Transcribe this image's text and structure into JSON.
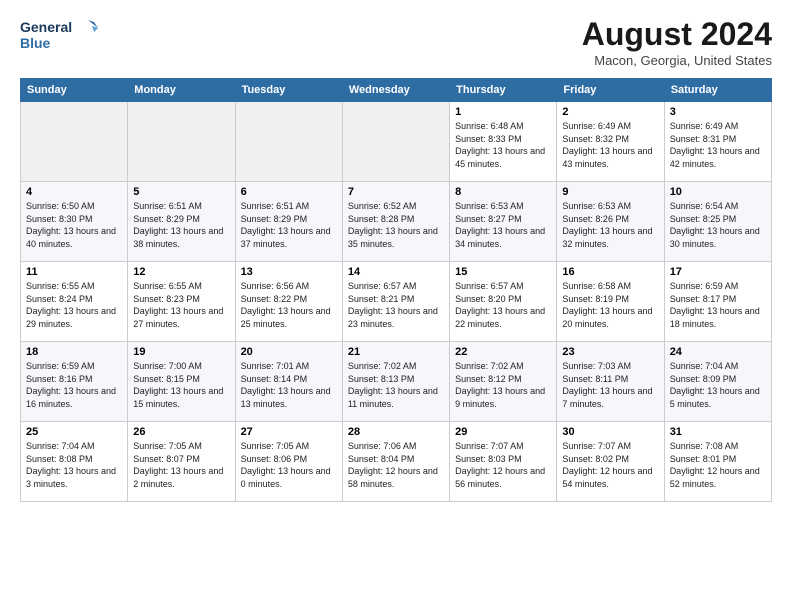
{
  "logo": {
    "line1": "General",
    "line2": "Blue"
  },
  "title": "August 2024",
  "location": "Macon, Georgia, United States",
  "days_of_week": [
    "Sunday",
    "Monday",
    "Tuesday",
    "Wednesday",
    "Thursday",
    "Friday",
    "Saturday"
  ],
  "weeks": [
    [
      {
        "day": "",
        "empty": true
      },
      {
        "day": "",
        "empty": true
      },
      {
        "day": "",
        "empty": true
      },
      {
        "day": "",
        "empty": true
      },
      {
        "day": "1",
        "sunrise": "6:48 AM",
        "sunset": "8:33 PM",
        "daylight": "13 hours and 45 minutes."
      },
      {
        "day": "2",
        "sunrise": "6:49 AM",
        "sunset": "8:32 PM",
        "daylight": "13 hours and 43 minutes."
      },
      {
        "day": "3",
        "sunrise": "6:49 AM",
        "sunset": "8:31 PM",
        "daylight": "13 hours and 42 minutes."
      }
    ],
    [
      {
        "day": "4",
        "sunrise": "6:50 AM",
        "sunset": "8:30 PM",
        "daylight": "13 hours and 40 minutes."
      },
      {
        "day": "5",
        "sunrise": "6:51 AM",
        "sunset": "8:29 PM",
        "daylight": "13 hours and 38 minutes."
      },
      {
        "day": "6",
        "sunrise": "6:51 AM",
        "sunset": "8:29 PM",
        "daylight": "13 hours and 37 minutes."
      },
      {
        "day": "7",
        "sunrise": "6:52 AM",
        "sunset": "8:28 PM",
        "daylight": "13 hours and 35 minutes."
      },
      {
        "day": "8",
        "sunrise": "6:53 AM",
        "sunset": "8:27 PM",
        "daylight": "13 hours and 34 minutes."
      },
      {
        "day": "9",
        "sunrise": "6:53 AM",
        "sunset": "8:26 PM",
        "daylight": "13 hours and 32 minutes."
      },
      {
        "day": "10",
        "sunrise": "6:54 AM",
        "sunset": "8:25 PM",
        "daylight": "13 hours and 30 minutes."
      }
    ],
    [
      {
        "day": "11",
        "sunrise": "6:55 AM",
        "sunset": "8:24 PM",
        "daylight": "13 hours and 29 minutes."
      },
      {
        "day": "12",
        "sunrise": "6:55 AM",
        "sunset": "8:23 PM",
        "daylight": "13 hours and 27 minutes."
      },
      {
        "day": "13",
        "sunrise": "6:56 AM",
        "sunset": "8:22 PM",
        "daylight": "13 hours and 25 minutes."
      },
      {
        "day": "14",
        "sunrise": "6:57 AM",
        "sunset": "8:21 PM",
        "daylight": "13 hours and 23 minutes."
      },
      {
        "day": "15",
        "sunrise": "6:57 AM",
        "sunset": "8:20 PM",
        "daylight": "13 hours and 22 minutes."
      },
      {
        "day": "16",
        "sunrise": "6:58 AM",
        "sunset": "8:19 PM",
        "daylight": "13 hours and 20 minutes."
      },
      {
        "day": "17",
        "sunrise": "6:59 AM",
        "sunset": "8:17 PM",
        "daylight": "13 hours and 18 minutes."
      }
    ],
    [
      {
        "day": "18",
        "sunrise": "6:59 AM",
        "sunset": "8:16 PM",
        "daylight": "13 hours and 16 minutes."
      },
      {
        "day": "19",
        "sunrise": "7:00 AM",
        "sunset": "8:15 PM",
        "daylight": "13 hours and 15 minutes."
      },
      {
        "day": "20",
        "sunrise": "7:01 AM",
        "sunset": "8:14 PM",
        "daylight": "13 hours and 13 minutes."
      },
      {
        "day": "21",
        "sunrise": "7:02 AM",
        "sunset": "8:13 PM",
        "daylight": "13 hours and 11 minutes."
      },
      {
        "day": "22",
        "sunrise": "7:02 AM",
        "sunset": "8:12 PM",
        "daylight": "13 hours and 9 minutes."
      },
      {
        "day": "23",
        "sunrise": "7:03 AM",
        "sunset": "8:11 PM",
        "daylight": "13 hours and 7 minutes."
      },
      {
        "day": "24",
        "sunrise": "7:04 AM",
        "sunset": "8:09 PM",
        "daylight": "13 hours and 5 minutes."
      }
    ],
    [
      {
        "day": "25",
        "sunrise": "7:04 AM",
        "sunset": "8:08 PM",
        "daylight": "13 hours and 3 minutes."
      },
      {
        "day": "26",
        "sunrise": "7:05 AM",
        "sunset": "8:07 PM",
        "daylight": "13 hours and 2 minutes."
      },
      {
        "day": "27",
        "sunrise": "7:05 AM",
        "sunset": "8:06 PM",
        "daylight": "13 hours and 0 minutes."
      },
      {
        "day": "28",
        "sunrise": "7:06 AM",
        "sunset": "8:04 PM",
        "daylight": "12 hours and 58 minutes."
      },
      {
        "day": "29",
        "sunrise": "7:07 AM",
        "sunset": "8:03 PM",
        "daylight": "12 hours and 56 minutes."
      },
      {
        "day": "30",
        "sunrise": "7:07 AM",
        "sunset": "8:02 PM",
        "daylight": "12 hours and 54 minutes."
      },
      {
        "day": "31",
        "sunrise": "7:08 AM",
        "sunset": "8:01 PM",
        "daylight": "12 hours and 52 minutes."
      }
    ]
  ],
  "labels": {
    "sunrise": "Sunrise:",
    "sunset": "Sunset:",
    "daylight": "Daylight:"
  }
}
